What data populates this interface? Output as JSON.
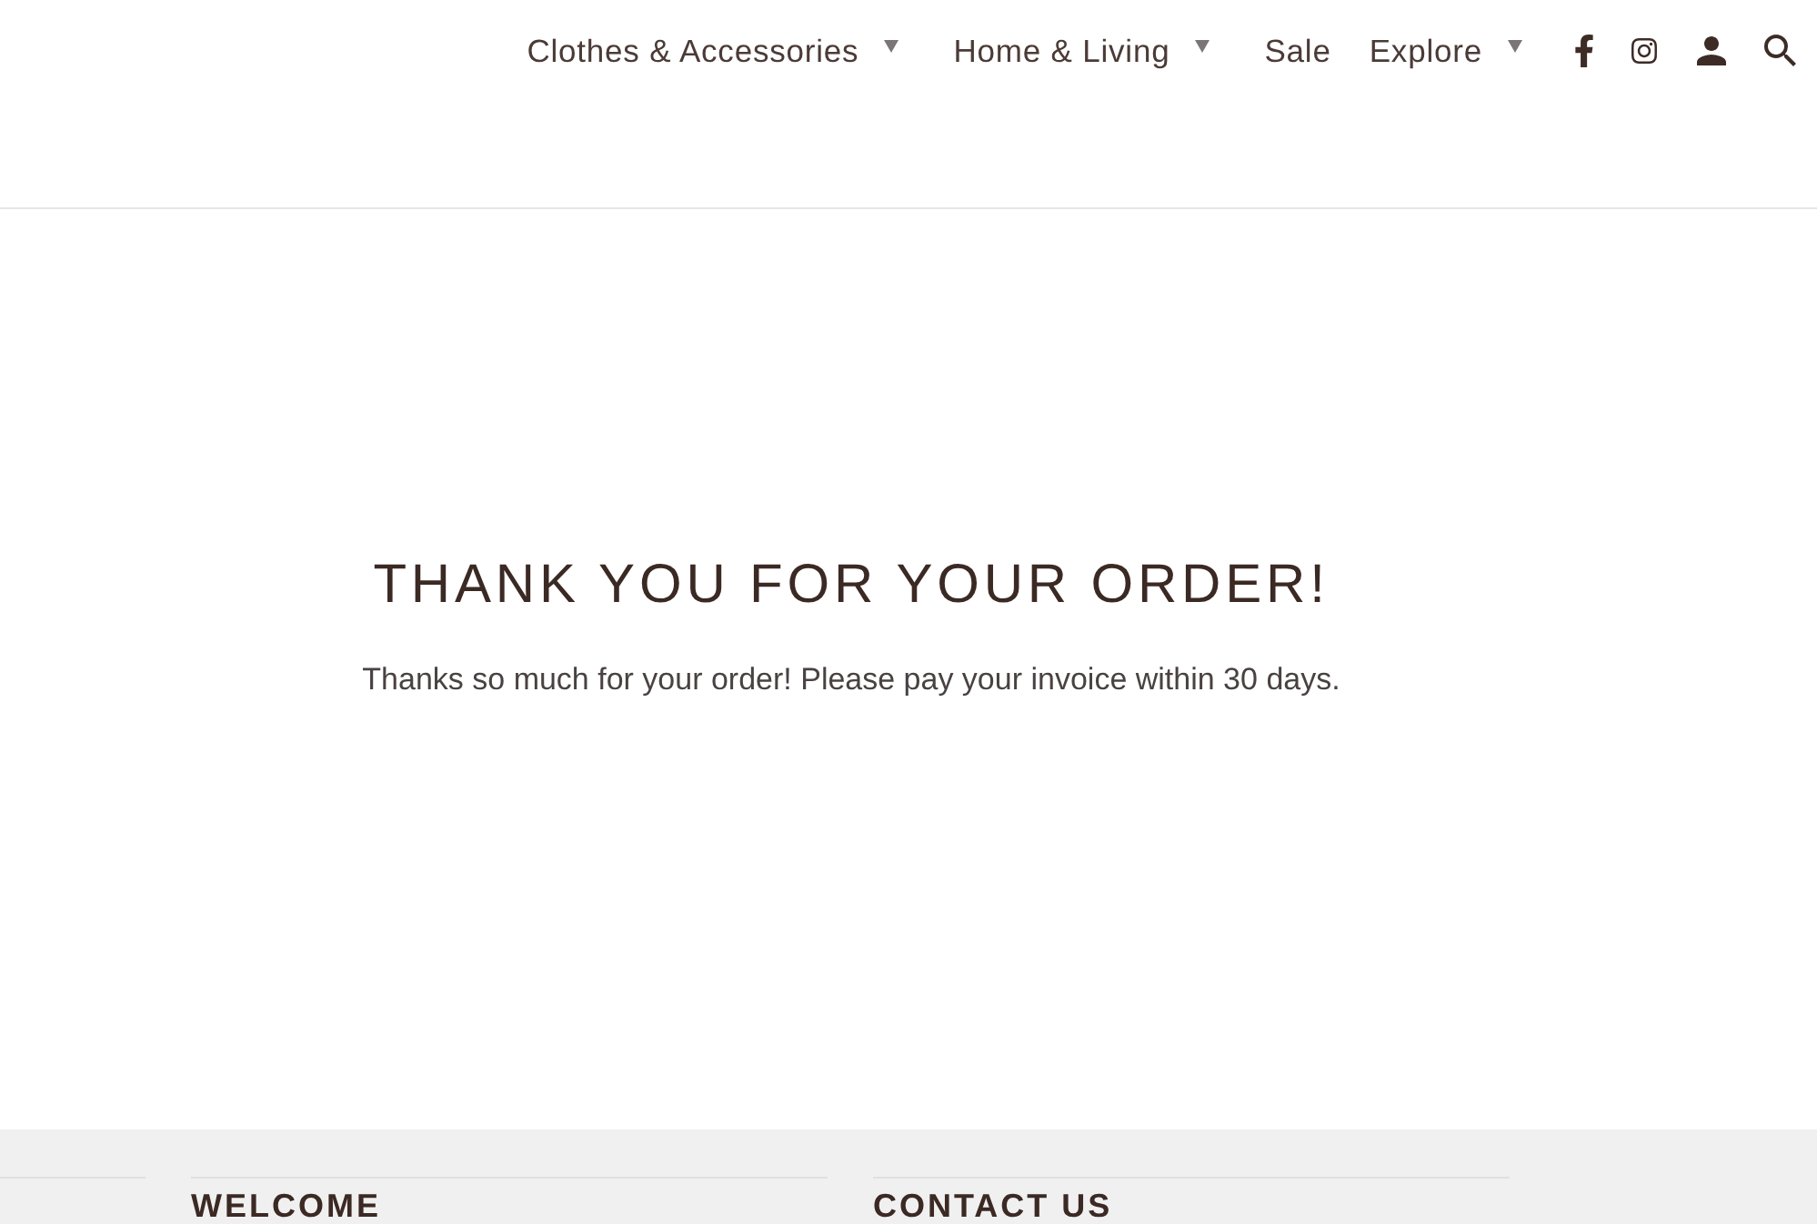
{
  "nav": {
    "items": [
      {
        "label": "Clothes & Accessories",
        "has_dropdown": true
      },
      {
        "label": "Home & Living",
        "has_dropdown": true
      },
      {
        "label": "Sale",
        "has_dropdown": false
      },
      {
        "label": "Explore",
        "has_dropdown": true
      }
    ]
  },
  "main": {
    "title": "THANK YOU FOR YOUR ORDER!",
    "message": "Thanks so much for your order! Please pay your invoice within 30 days."
  },
  "footer": {
    "columns": [
      {
        "heading": "WELCOME"
      },
      {
        "heading": "CONTACT US"
      }
    ]
  }
}
